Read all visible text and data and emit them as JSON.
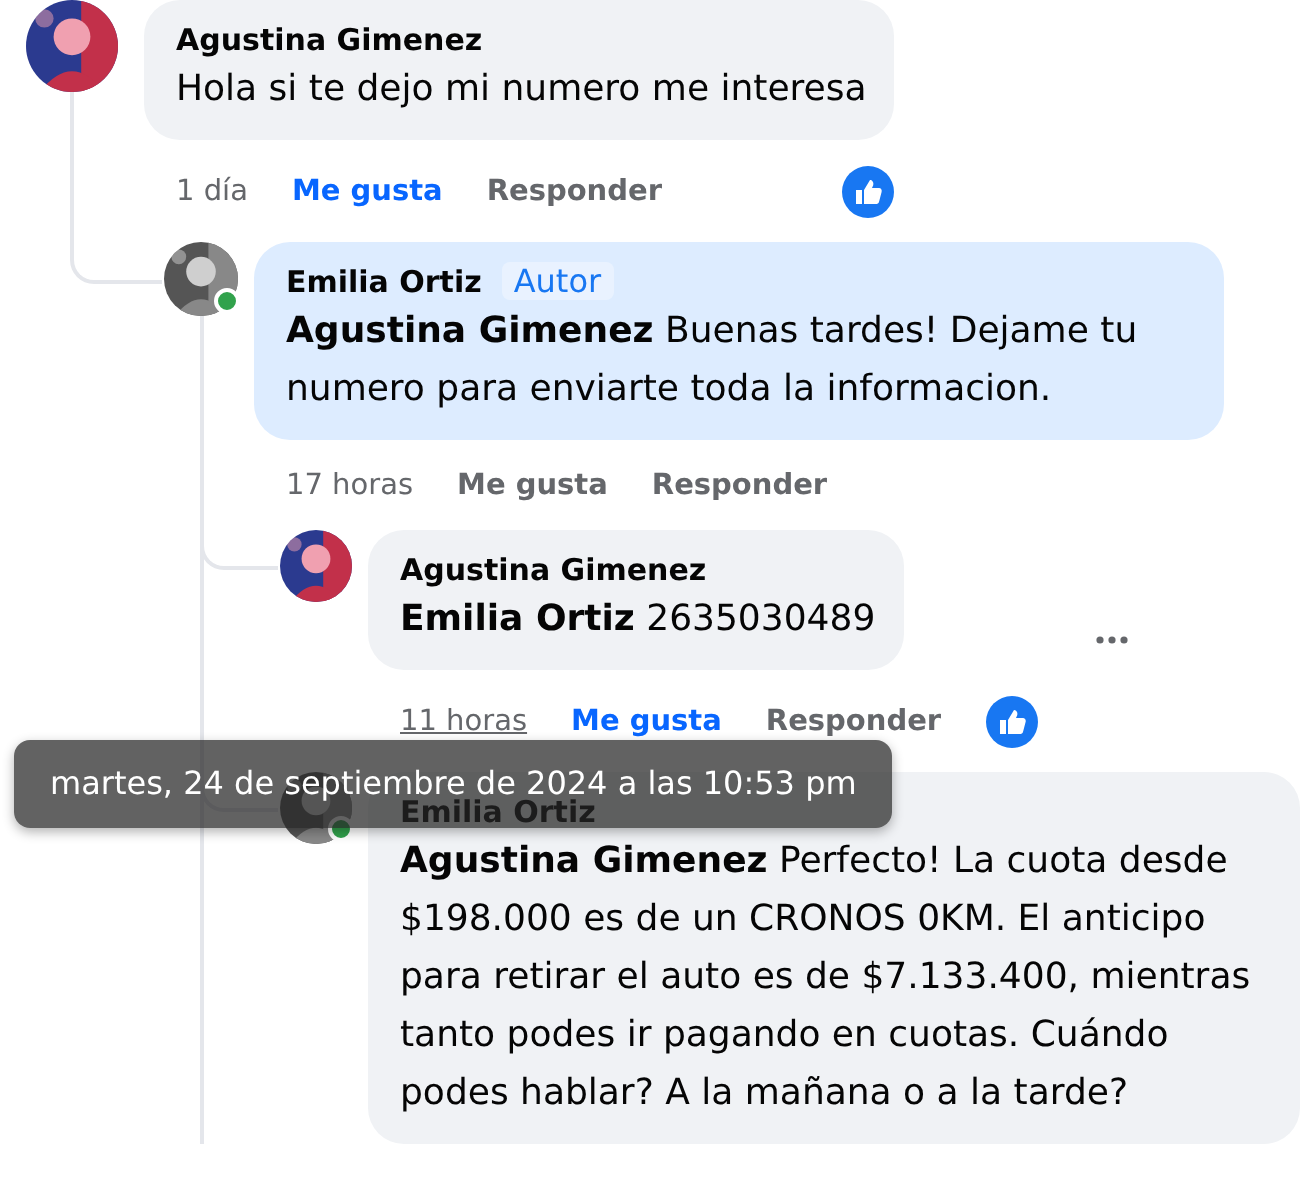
{
  "comments": [
    {
      "author": "Agustina Gimenez",
      "online": false,
      "highlighted": false,
      "text": "Hola si te dejo mi numero me interesa",
      "time": "1 día",
      "time_hovered": false,
      "like_label": "Me gusta",
      "liked": true,
      "reply_label": "Responder",
      "reaction": true,
      "more_button": false,
      "thread_continues": false,
      "children": [
        {
          "author": "Emilia Ortiz",
          "badge": "Autor",
          "online": true,
          "highlighted": true,
          "text": "**Agustina Gimenez** Buenas tardes! Dejame tu numero para enviarte toda la informacion.",
          "time": "17 horas",
          "time_hovered": false,
          "like_label": "Me gusta",
          "liked": false,
          "reply_label": "Responder",
          "reaction": false,
          "more_button": false,
          "thread_continues": true,
          "children": [
            {
              "author": "Agustina Gimenez",
              "online": false,
              "highlighted": false,
              "text": "**Emilia Ortiz** 2635030489",
              "time": "11 horas",
              "time_hovered": true,
              "like_label": "Me gusta",
              "liked": true,
              "reply_label": "Responder",
              "reaction": true,
              "more_button": true
            },
            {
              "author": "Emilia Ortiz",
              "online": true,
              "highlighted": false,
              "text": "**Agustina Gimenez** Perfecto! La cuota desde $198.000 es de un CRONOS 0KM. El anticipo para retirar el auto es de $7.133.400, mientras tanto podes ir pagando en cuotas. Cuándo podes hablar? A la mañana o a la tarde?",
              "more_button": false
            }
          ]
        }
      ]
    }
  ],
  "tooltip": {
    "text": "martes, 24 de septiembre de 2024 a las 10:53 pm"
  }
}
